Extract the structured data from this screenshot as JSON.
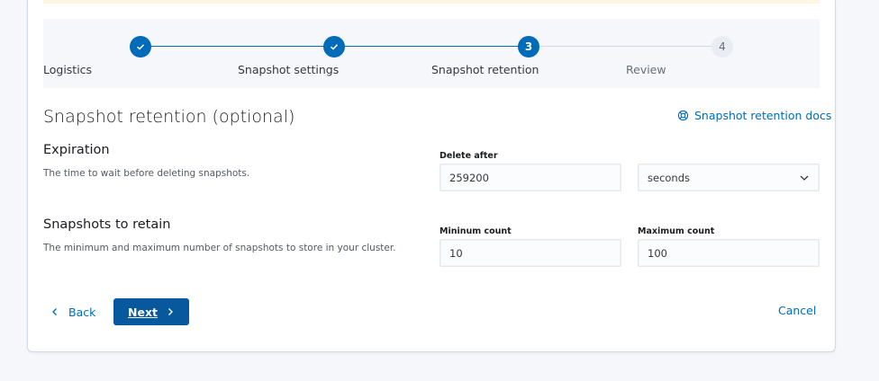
{
  "steps": [
    {
      "label": "Logistics",
      "status": "complete",
      "number": "1"
    },
    {
      "label": "Snapshot settings",
      "status": "complete",
      "number": "2"
    },
    {
      "label": "Snapshot retention",
      "status": "current",
      "number": "3"
    },
    {
      "label": "Review",
      "status": "incomplete",
      "number": "4"
    }
  ],
  "page": {
    "title": "Snapshot retention (optional)",
    "docs_link": "Snapshot retention docs",
    "docs_icon": "lifebuoy-icon"
  },
  "expiration": {
    "title": "Expiration",
    "description": "The time to wait before deleting snapshots.",
    "delete_after_label": "Delete after",
    "delete_after_value": "259200",
    "unit_value": "seconds"
  },
  "retain": {
    "title": "Snapshots to retain",
    "description": "The minimum and maximum number of snapshots to store in your cluster.",
    "min_label": "Mininum count",
    "min_value": "10",
    "max_label": "Maximum count",
    "max_value": "100"
  },
  "footer": {
    "back_label": "Back",
    "next_label": "Next",
    "cancel_label": "Cancel"
  },
  "colors": {
    "primary": "#006bb8",
    "primary_button": "#07589d",
    "incomplete_step": "#e9edf3"
  }
}
